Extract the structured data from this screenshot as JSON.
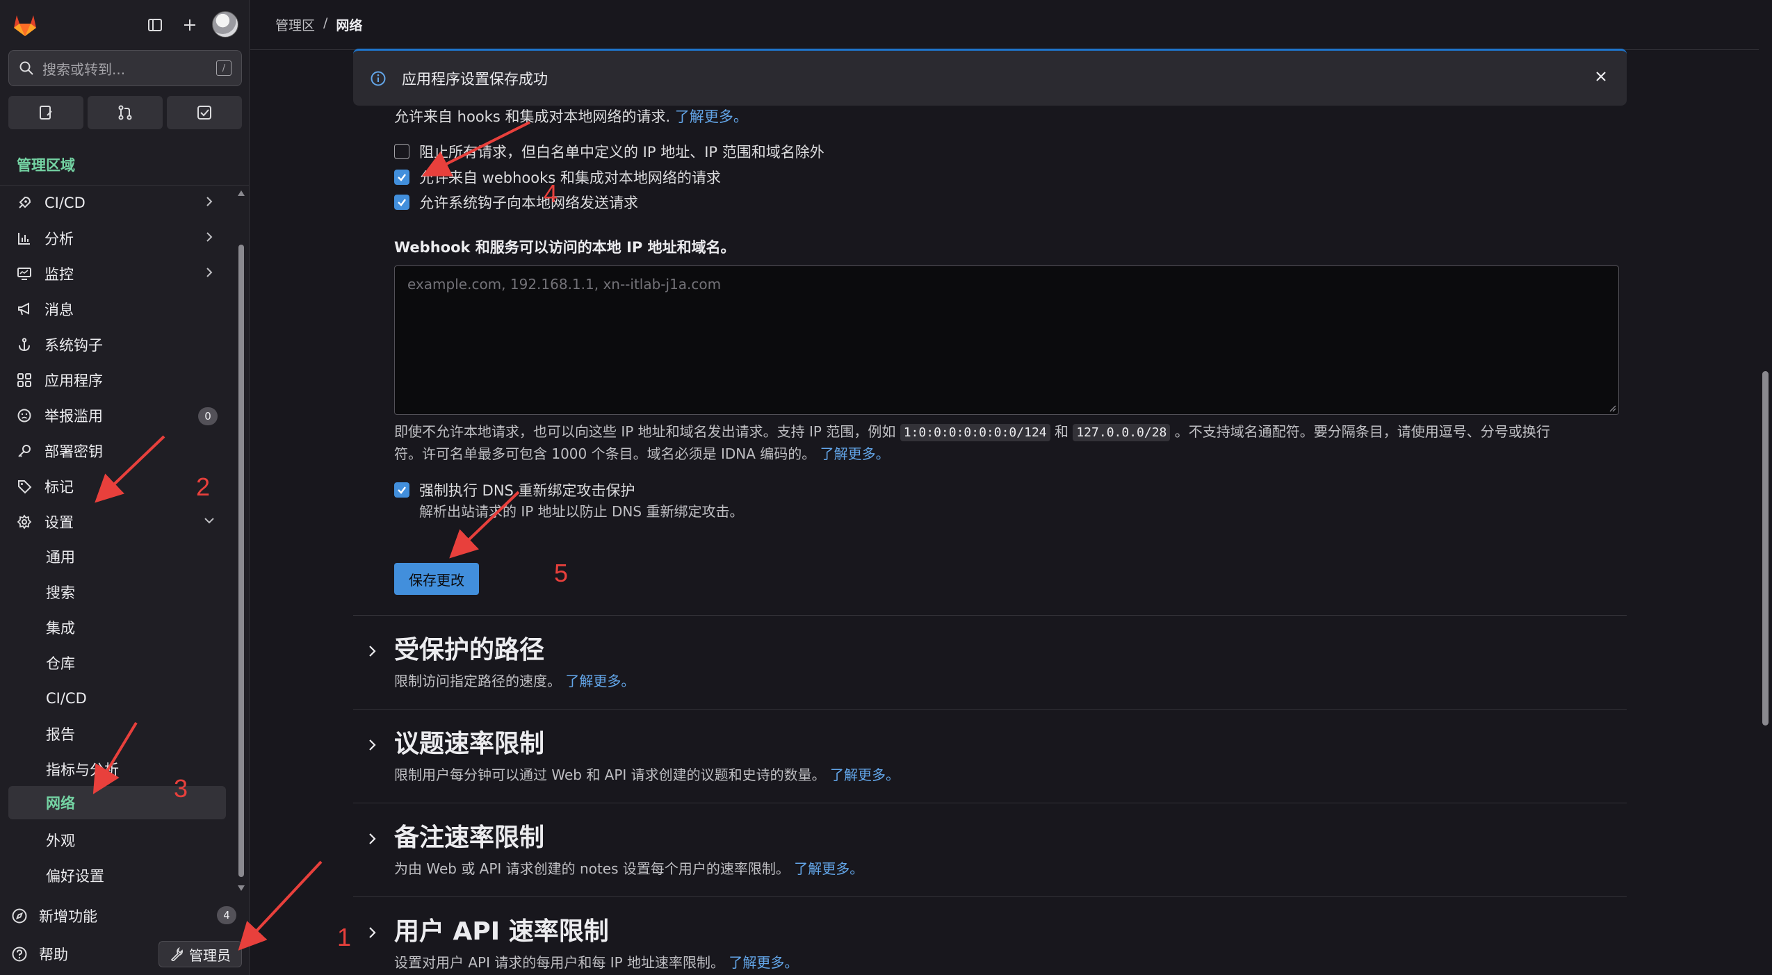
{
  "sidebar": {
    "search_placeholder": "搜索或转到...",
    "search_shortcut": "/",
    "area_title": "管理区域",
    "items": [
      {
        "label": "CI/CD"
      },
      {
        "label": "分析"
      },
      {
        "label": "监控"
      },
      {
        "label": "消息"
      },
      {
        "label": "系统钩子"
      },
      {
        "label": "应用程序"
      },
      {
        "label": "举报滥用",
        "badge": "0"
      },
      {
        "label": "部署密钥"
      },
      {
        "label": "标记"
      },
      {
        "label": "设置"
      }
    ],
    "settings_sub": [
      "通用",
      "搜索",
      "集成",
      "仓库",
      "CI/CD",
      "报告",
      "指标与分析",
      "网络",
      "外观",
      "偏好设置"
    ],
    "new_features": "新增功能",
    "new_features_badge": "4",
    "help": "帮助",
    "admin_button": "管理员"
  },
  "breadcrumb": {
    "root": "管理区",
    "separator": "/",
    "current": "网络"
  },
  "alert": {
    "message": "应用程序设置保存成功"
  },
  "outbound": {
    "intro": "允许来自 hooks 和集成对本地网络的请求.",
    "learn_more": "了解更多。",
    "options": [
      {
        "label": "阻止所有请求，但白名单中定义的 IP 地址、IP 范围和域名除外",
        "checked": false
      },
      {
        "label": "允许来自 webhooks 和集成对本地网络的请求",
        "checked": true
      },
      {
        "label": "允许系统钩子向本地网络发送请求",
        "checked": true
      }
    ],
    "allowlist_label": "Webhook 和服务可以访问的本地 IP 地址和域名。",
    "allowlist_placeholder": "example.com, 192.168.1.1, xn--itlab-j1a.com",
    "help_part1": "即使不允许本地请求，也可以向这些 IP 地址和域名发出请求。支持 IP 范围，例如",
    "code1": "1:0:0:0:0:0:0:0/124",
    "help_and": "和",
    "code2": "127.0.0.0/28",
    "help_part2": "。不支持域名通配符。要分隔条目，请使用逗号、分号或换行",
    "help_part3": "符。许可名单最多可包含 1000 个条目。域名必须是 IDNA 编码的。",
    "help_link": "了解更多。",
    "dns_label": "强制执行 DNS 重新绑定攻击保护",
    "dns_checked": true,
    "dns_help": "解析出站请求的 IP 地址以防止 DNS 重新绑定攻击。",
    "save_button": "保存更改"
  },
  "sections": [
    {
      "title": "受保护的路径",
      "desc": "限制访问指定路径的速度。",
      "link": "了解更多。"
    },
    {
      "title": "议题速率限制",
      "desc": "限制用户每分钟可以通过 Web 和 API 请求创建的议题和史诗的数量。",
      "link": "了解更多。"
    },
    {
      "title": "备注速率限制",
      "desc": "为由 Web 或 API 请求创建的 notes 设置每个用户的速率限制。",
      "link": "了解更多。"
    },
    {
      "title": "用户 API 速率限制",
      "desc": "设置对用户 API 请求的每用户和每 IP 地址速率限制。",
      "link": "了解更多。"
    }
  ],
  "annotations": [
    "1",
    "2",
    "3",
    "4",
    "5"
  ],
  "colors": {
    "accent": "#428fdc",
    "active_nav": "#74d3a3",
    "annotation": "#e8403c"
  }
}
